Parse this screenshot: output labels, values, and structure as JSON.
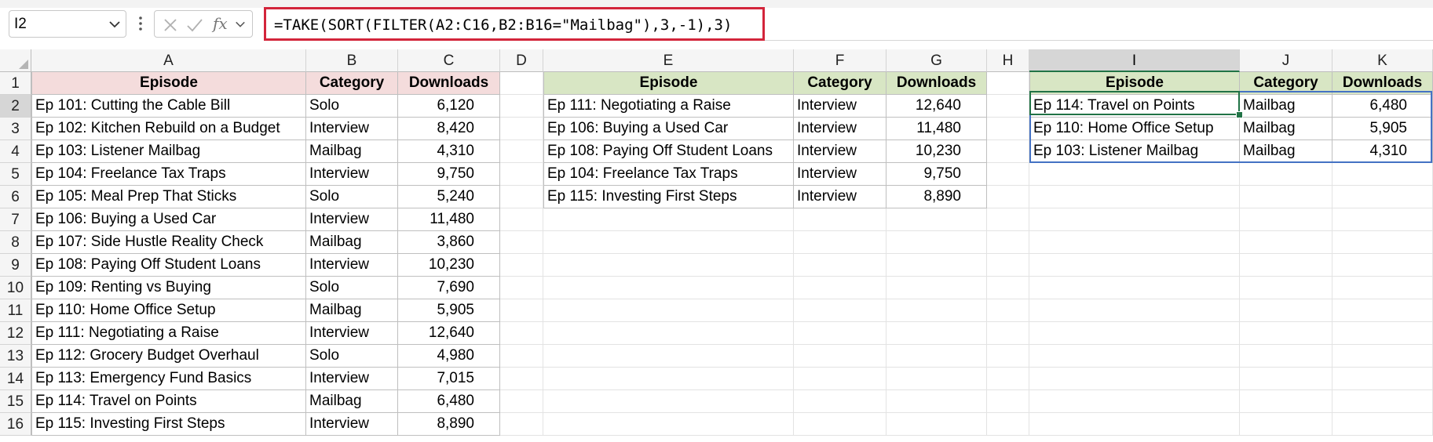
{
  "formula_bar": {
    "name_box": "I2",
    "formula": "=TAKE(SORT(FILTER(A2:C16,B2:B16=\"Mailbag\"),3,-1),3)",
    "fx_label": "fx"
  },
  "columns": [
    "A",
    "B",
    "C",
    "D",
    "E",
    "F",
    "G",
    "H",
    "I",
    "J",
    "K"
  ],
  "rows": [
    "1",
    "2",
    "3",
    "4",
    "5",
    "6",
    "7",
    "8",
    "9",
    "10",
    "11",
    "12",
    "13",
    "14",
    "15",
    "16"
  ],
  "source_table": {
    "headers": [
      "Episode",
      "Category",
      "Downloads"
    ],
    "rows": [
      [
        "Ep 101: Cutting the Cable Bill",
        "Solo",
        "6,120"
      ],
      [
        "Ep 102: Kitchen Rebuild on a Budget",
        "Interview",
        "8,420"
      ],
      [
        "Ep 103: Listener Mailbag",
        "Mailbag",
        "4,310"
      ],
      [
        "Ep 104: Freelance Tax Traps",
        "Interview",
        "9,750"
      ],
      [
        "Ep 105: Meal Prep That Sticks",
        "Solo",
        "5,240"
      ],
      [
        "Ep 106: Buying a Used Car",
        "Interview",
        "11,480"
      ],
      [
        "Ep 107: Side Hustle Reality Check",
        "Mailbag",
        "3,860"
      ],
      [
        "Ep 108: Paying Off Student Loans",
        "Interview",
        "10,230"
      ],
      [
        "Ep 109: Renting vs Buying",
        "Solo",
        "7,690"
      ],
      [
        "Ep 110: Home Office Setup",
        "Mailbag",
        "5,905"
      ],
      [
        "Ep 111: Negotiating a Raise",
        "Interview",
        "12,640"
      ],
      [
        "Ep 112: Grocery Budget Overhaul",
        "Solo",
        "4,980"
      ],
      [
        "Ep 113: Emergency Fund Basics",
        "Interview",
        "7,015"
      ],
      [
        "Ep 114: Travel on Points",
        "Mailbag",
        "6,480"
      ],
      [
        "Ep 115: Investing First Steps",
        "Interview",
        "8,890"
      ]
    ]
  },
  "top_interview_table": {
    "headers": [
      "Episode",
      "Category",
      "Downloads"
    ],
    "rows": [
      [
        "Ep 111: Negotiating a Raise",
        "Interview",
        "12,640"
      ],
      [
        "Ep 106: Buying a Used Car",
        "Interview",
        "11,480"
      ],
      [
        "Ep 108: Paying Off Student Loans",
        "Interview",
        "10,230"
      ],
      [
        "Ep 104: Freelance Tax Traps",
        "Interview",
        "9,750"
      ],
      [
        "Ep 115: Investing First Steps",
        "Interview",
        "8,890"
      ]
    ]
  },
  "mailbag_result_table": {
    "headers": [
      "Episode",
      "Category",
      "Downloads"
    ],
    "rows": [
      [
        "Ep 114: Travel on Points",
        "Mailbag",
        "6,480"
      ],
      [
        "Ep 110: Home Office Setup",
        "Mailbag",
        "5,905"
      ],
      [
        "Ep 103: Listener Mailbag",
        "Mailbag",
        "4,310"
      ]
    ]
  },
  "selection": {
    "active_cell": "I2",
    "active_column": "I",
    "active_row": "2"
  },
  "colors": {
    "source_header": "#f4dcdc",
    "result_header": "#d8e6c4",
    "formula_highlight": "#d3253b",
    "active_cell": "#217346",
    "spill_border": "#4472c4"
  }
}
